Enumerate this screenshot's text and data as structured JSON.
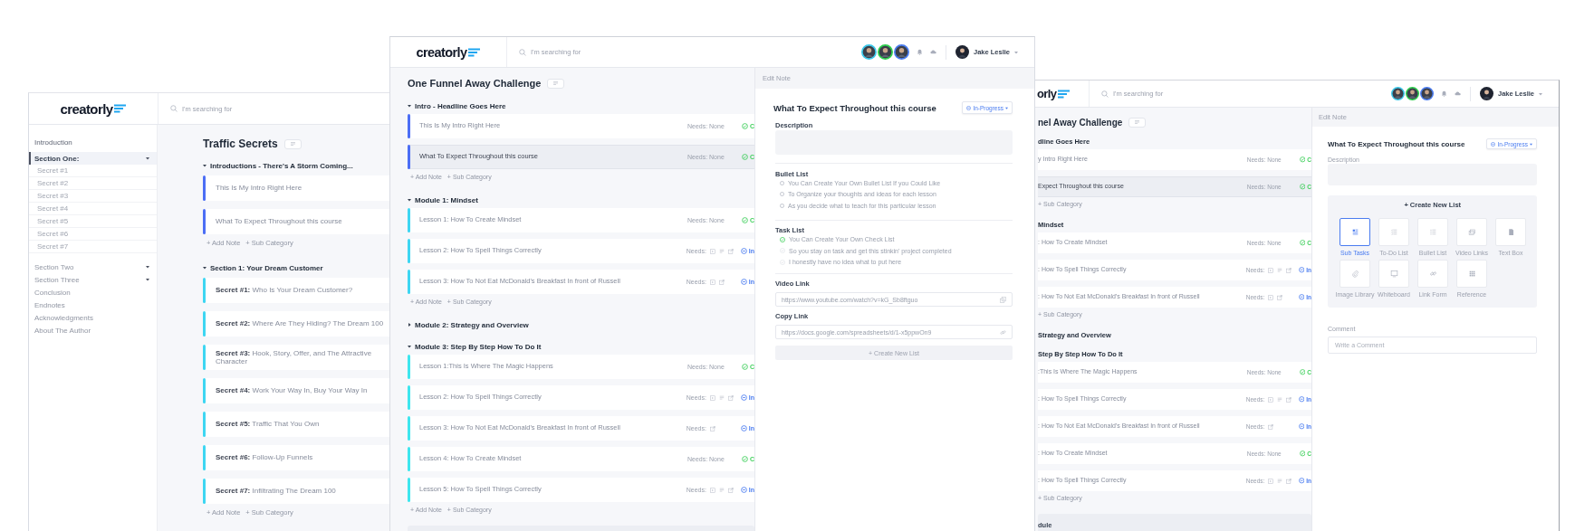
{
  "windows": [
    {
      "kind": "sidebar",
      "logo": "creatorly",
      "search_placeholder": "I'm searching for",
      "sidebar": [
        {
          "label": "Introduction",
          "selected": false,
          "expandable": false
        },
        {
          "label": "Section One:",
          "selected": true,
          "expandable": true,
          "children": [
            {
              "label": "Secret #1"
            },
            {
              "label": "Secret #2"
            },
            {
              "label": "Secret #3"
            },
            {
              "label": "Secret #4"
            },
            {
              "label": "Secret #5"
            },
            {
              "label": "Secret #6"
            },
            {
              "label": "Secret #7"
            }
          ]
        },
        {
          "label": "Section Two",
          "selected": false,
          "expandable": true
        },
        {
          "label": "Section Three",
          "selected": false,
          "expandable": true
        },
        {
          "label": "Conclusion",
          "selected": false,
          "expandable": false
        },
        {
          "label": "Endnotes",
          "selected": false,
          "expandable": false
        },
        {
          "label": "Acknowledgments",
          "selected": false,
          "expandable": false
        },
        {
          "label": "About The Author",
          "selected": false,
          "expandable": false
        }
      ],
      "title": "Traffic Secrets",
      "sections": [
        {
          "title": "Introductions - There's A Storm Coming...",
          "expanded": true,
          "notes": [
            {
              "title": "This Is My Intro Right Here",
              "color": "#4c6ef5",
              "selected": false
            },
            {
              "title": "What To Expect Throughout this course",
              "color": "#4c6ef5",
              "selected": false
            }
          ],
          "actions": [
            "+ Add Note",
            "+ Sub Category"
          ]
        },
        {
          "title": "Section 1: Your Dream Customer",
          "expanded": true,
          "notes": [
            {
              "title": "**Secret #1:** Who Is Your Dream Customer?",
              "color": "#3ed6f2",
              "selected": false
            },
            {
              "title": "**Secret #2:** Where Are They Hiding? The Dream 100",
              "color": "#3ed6f2",
              "selected": false
            },
            {
              "title": "**Secret #3:** Hook, Story, Offer, and The Attractive Character",
              "color": "#3ed6f2",
              "selected": false
            },
            {
              "title": "**Secret #4:** Work Your Way In, Buy Your Way In",
              "color": "#3ed6f2",
              "selected": false
            },
            {
              "title": "**Secret #5:** Traffic That You Own",
              "color": "#3ed6f2",
              "selected": false
            },
            {
              "title": "**Secret #6:** Follow-Up Funnels",
              "color": "#3ed6f2",
              "selected": false
            },
            {
              "title": "**Secret #7:** Infiltrating The Dream 100",
              "color": "#3ed6f2",
              "selected": false
            }
          ],
          "actions": [
            "+ Add Note",
            "+ Sub Category"
          ]
        }
      ]
    },
    {
      "kind": "editor",
      "logo": "creatorly",
      "search_placeholder": "I'm searching for",
      "avatars": [
        {
          "color": "#3cc8ea"
        },
        {
          "color": "#2fcf4f"
        },
        {
          "color": "#4a7cf0"
        }
      ],
      "user": "Jake Leslie",
      "title": "One Funnel Away Challenge",
      "sections": [
        {
          "title": "**Intro** - Headline Goes Here",
          "expanded": true,
          "notes": [
            {
              "title": "This Is My Intro Right Here",
              "color": "#4c6ef5",
              "selected": false,
              "needs": "Needs: None",
              "complete": true,
              "status_text": "C"
            },
            {
              "title": "What To Expect Throughout this course",
              "color": "#4c6ef5",
              "selected": true,
              "needs": "Needs: None",
              "complete": true,
              "status_text": "C"
            }
          ],
          "actions": [
            "+ Add Note",
            "+ Sub Category"
          ]
        },
        {
          "title": "**Module 1:** Mindset",
          "expanded": true,
          "notes": [
            {
              "title": "Lesson 1: How To Create Mindset",
              "color": "#3ed6f2",
              "selected": false,
              "needs": "Needs: None",
              "complete": true,
              "status_text": "C"
            },
            {
              "title": "Lesson 2: How To Spell Things Correctly",
              "color": "#3ed6f2",
              "selected": false,
              "needs": "Needs:",
              "need_icons": [
                {
                  "kind": "video"
                },
                {
                  "kind": "list"
                },
                {
                  "kind": "share"
                }
              ],
              "complete": false,
              "status_text": "In"
            },
            {
              "title": "Lesson 3: How To Not Eat McDonald's Breakfast In front of Russell",
              "color": "#3ed6f2",
              "selected": false,
              "needs": "Needs:",
              "need_icons": [
                {
                  "kind": "video"
                },
                {
                  "kind": "share"
                }
              ],
              "complete": false,
              "status_text": "In"
            }
          ],
          "actions": [
            "+ Add Note",
            "+ Sub Category"
          ]
        },
        {
          "title": "**Module 2:** Strategy and Overview",
          "expanded": false
        },
        {
          "title": "**Module 3:** Step By Step How To Do It",
          "expanded": true,
          "notes": [
            {
              "title": "Lesson 1:This Is Where The Magic Happens",
              "color": "#3ee6ee",
              "selected": false,
              "needs": "Needs: None",
              "complete": true,
              "status_text": "C"
            },
            {
              "title": "Lesson 2: How To Spell Things Correctly",
              "color": "#3ee6ee",
              "selected": false,
              "needs": "Needs:",
              "need_icons": [
                {
                  "kind": "video"
                },
                {
                  "kind": "list"
                },
                {
                  "kind": "share"
                }
              ],
              "complete": false,
              "status_text": "In"
            },
            {
              "title": "Lesson 3: How To Not Eat McDonald's Breakfast In front of Russell",
              "color": "#3ee6ee",
              "selected": false,
              "needs": "Needs:",
              "need_icons": [
                {
                  "kind": "share"
                }
              ],
              "complete": false,
              "status_text": "In"
            },
            {
              "title": "Lesson 4: How To Create Mindset",
              "color": "#3ee6ee",
              "selected": false,
              "needs": "Needs: None",
              "complete": true,
              "status_text": "C"
            },
            {
              "title": "Lesson 5: How To Spell Things Correctly",
              "color": "#3ee6ee",
              "selected": false,
              "needs": "Needs:",
              "need_icons": [
                {
                  "kind": "video"
                },
                {
                  "kind": "list"
                },
                {
                  "kind": "share"
                }
              ],
              "complete": false,
              "status_text": "In"
            }
          ],
          "actions": [
            "+ Add Note",
            "+ Sub Category"
          ]
        }
      ],
      "panel": {
        "header": "Edit Note",
        "title": "What To Expect Throughout this course",
        "status": "In-Progress",
        "sections": [
          {
            "kind": "description",
            "label": "Description"
          },
          {
            "kind": "bullets",
            "label": "Bullet List",
            "items": [
              {
                "text": "You Can Create Your Own Bullet List If you Could Like"
              },
              {
                "text": "To Organize your thoughts and ideas for each lesson"
              },
              {
                "text": "As you decide what to teach for this particular lesson"
              }
            ]
          },
          {
            "kind": "tasks",
            "label": "Task List",
            "items": [
              {
                "text": "You Can Create Your Own Check List",
                "checked": true
              },
              {
                "text": "So you stay on task and get this stinkin' project completed",
                "checked": false
              },
              {
                "text": "I honestly have no idea what to put here",
                "checked": false
              }
            ]
          },
          {
            "kind": "link",
            "label": "Video Link",
            "value": "https://www.youtube.com/watch?v=kG_Sb8ftguo"
          },
          {
            "kind": "link",
            "label": "Copy Link",
            "value": "https://docs.google.com/spreadsheets/d/1-x5ppwOn9"
          },
          {
            "kind": "button",
            "label": "+ Create New List"
          }
        ]
      }
    },
    {
      "kind": "editor",
      "logo": "orly",
      "search_placeholder": "I'm searching for",
      "avatars": [
        {
          "color": "#3cc8ea"
        },
        {
          "color": "#2fcf4f"
        },
        {
          "color": "#4a7cf0"
        }
      ],
      "user": "Jake Leslie",
      "title": "nel Away Challenge",
      "sections": [
        {
          "title": "dline Goes Here",
          "notes": [
            {
              "title": "y Intro Right Here",
              "selected": false,
              "needs": "Needs: None",
              "complete": true,
              "status_text": "C"
            },
            {
              "title": "Expect Throughout this course",
              "selected": true,
              "needs": "Needs: None",
              "complete": true,
              "status_text": "C"
            }
          ],
          "actions": [
            "+ Sub Category"
          ]
        },
        {
          "title": "Mindset",
          "notes": [
            {
              "title": ": How To Create Mindset",
              "selected": false,
              "needs": "Needs: None",
              "complete": true,
              "status_text": "C"
            },
            {
              "title": ": How To Spell Things Correctly",
              "selected": false,
              "needs": "Needs:",
              "need_icons": [
                {
                  "kind": "video"
                },
                {
                  "kind": "list"
                },
                {
                  "kind": "share"
                }
              ],
              "complete": false,
              "status_text": "In"
            },
            {
              "title": ": How To Not Eat McDonald's Breakfast In front of Russell",
              "selected": false,
              "needs": "Needs:",
              "need_icons": [
                {
                  "kind": "video"
                },
                {
                  "kind": "share"
                }
              ],
              "complete": false,
              "status_text": "In"
            }
          ],
          "actions": [
            "+ Sub Category"
          ]
        },
        {
          "title": "Strategy and Overview"
        },
        {
          "title": "Step By Step How To Do It",
          "notes": [
            {
              "title": ":This Is Where The Magic Happens",
              "selected": false,
              "needs": "Needs: None",
              "complete": true,
              "status_text": "C"
            },
            {
              "title": ": How To Spell Things Correctly",
              "selected": false,
              "needs": "Needs:",
              "need_icons": [
                {
                  "kind": "video"
                },
                {
                  "kind": "list"
                },
                {
                  "kind": "share"
                }
              ],
              "complete": false,
              "status_text": "In"
            },
            {
              "title": ": How To Not Eat McDonald's Breakfast In front of Russell",
              "selected": false,
              "needs": "Needs:",
              "need_icons": [
                {
                  "kind": "share"
                }
              ],
              "complete": false,
              "status_text": "In"
            },
            {
              "title": ": How To Create Mindset",
              "selected": false,
              "needs": "Needs: None",
              "complete": true,
              "status_text": "C"
            },
            {
              "title": ": How To Spell Things Correctly",
              "selected": false,
              "needs": "Needs:",
              "need_icons": [
                {
                  "kind": "video"
                },
                {
                  "kind": "list"
                },
                {
                  "kind": "share"
                }
              ],
              "complete": false,
              "status_text": "In"
            }
          ],
          "actions": [
            "+ Sub Category"
          ]
        }
      ],
      "footer": "dule",
      "panel": {
        "header": "Edit Note",
        "title": "What To Expect Throughout this course",
        "status": "In-Progress",
        "sections": [
          {
            "kind": "description",
            "label": "Description"
          },
          {
            "kind": "picker",
            "title": "+ Create New List",
            "options": [
              {
                "label": "Sub Tasks",
                "selected": true
              },
              {
                "label": "To-Do List",
                "selected": false
              },
              {
                "label": "Bullet List",
                "selected": false
              },
              {
                "label": "Video Links",
                "selected": false
              },
              {
                "label": "Text Box",
                "selected": false
              },
              {
                "label": "Image Library",
                "selected": false
              },
              {
                "label": "Whiteboard",
                "selected": false
              },
              {
                "label": "Link Form",
                "selected": false
              },
              {
                "label": "Reference",
                "selected": false
              }
            ]
          },
          {
            "kind": "comment",
            "label": "Comment",
            "placeholder": "Write a Comment"
          }
        ]
      }
    }
  ]
}
